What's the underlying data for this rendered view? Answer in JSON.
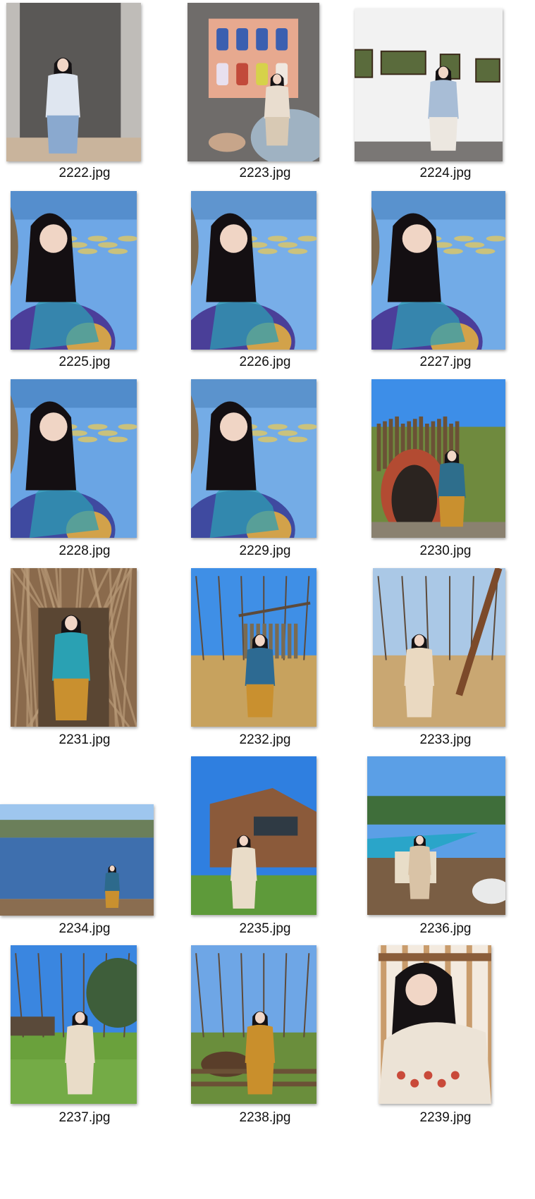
{
  "files": [
    {
      "name": "2222.jpg",
      "scene": "gray-wall-portrait",
      "sky": "#bfbcb8",
      "ground": "#c9b49c",
      "outfit": "#dfe6f0",
      "accent": "#5a5856"
    },
    {
      "name": "2223.jpg",
      "scene": "toy-shelf-interior",
      "sky": "#6f6c6a",
      "ground": "#c7a58a",
      "outfit": "#e9ddcf",
      "accent": "#3b5fb0"
    },
    {
      "name": "2224.jpg",
      "scene": "gallery-wall",
      "sky": "#f2f2f2",
      "ground": "#7a7775",
      "outfit": "#a8bdd6",
      "accent": "#5a6b3c"
    },
    {
      "name": "2225.jpg",
      "scene": "lakeside-sweater",
      "sky": "#6ea7e6",
      "ground": "#7e6a4f",
      "outfit": "#4b3e9a",
      "accent": "#d2a24a"
    },
    {
      "name": "2226.jpg",
      "scene": "lakeside-sweater",
      "sky": "#78aee8",
      "ground": "#7e6a4f",
      "outfit": "#4a3f98",
      "accent": "#d2a24a"
    },
    {
      "name": "2227.jpg",
      "scene": "lakeside-sweater",
      "sky": "#72abe7",
      "ground": "#7e6a4f",
      "outfit": "#4b3e9a",
      "accent": "#d2a24a"
    },
    {
      "name": "2228.jpg",
      "scene": "lakeside-sweater",
      "sky": "#6aa5e4",
      "ground": "#8a6f4e",
      "outfit": "#3f4aa0",
      "accent": "#d2a24a"
    },
    {
      "name": "2229.jpg",
      "scene": "lakeside-sweater",
      "sky": "#74ace6",
      "ground": "#8a6f4e",
      "outfit": "#3f4aa0",
      "accent": "#d2a24a"
    },
    {
      "name": "2230.jpg",
      "scene": "hobbit-door",
      "sky": "#3d8ee8",
      "ground": "#6f8a3e",
      "outfit": "#2e6e8c",
      "accent": "#b34b32"
    },
    {
      "name": "2231.jpg",
      "scene": "branch-hut",
      "sky": "#8a6a4c",
      "ground": "#5a4633",
      "outfit": "#c9902f",
      "accent": "#3aa1a6"
    },
    {
      "name": "2232.jpg",
      "scene": "park-swing",
      "sky": "#3f8fe6",
      "ground": "#c7a25e",
      "outfit": "#2d6a92",
      "accent": "#7a6b52"
    },
    {
      "name": "2233.jpg",
      "scene": "garden-fence",
      "sky": "#aac8e6",
      "ground": "#c9a772",
      "outfit": "#ead9c1",
      "accent": "#7c4a2a"
    },
    {
      "name": "2234.jpg",
      "scene": "wide-lake",
      "sky": "#9ec6ee",
      "ground": "#3e6fae",
      "outfit": "#2d6a8c",
      "accent": "#6b7f5a"
    },
    {
      "name": "2235.jpg",
      "scene": "wooden-house",
      "sky": "#2f7fe0",
      "ground": "#5e9a3a",
      "outfit": "#e9dcc8",
      "accent": "#8b5a3a"
    },
    {
      "name": "2236.jpg",
      "scene": "poolside-chair",
      "sky": "#5b9fe6",
      "ground": "#7a5e44",
      "outfit": "#d9c3a6",
      "accent": "#2aa5c9"
    },
    {
      "name": "2237.jpg",
      "scene": "garden-path",
      "sky": "#3a86e0",
      "ground": "#6aa13c",
      "outfit": "#e9dcc8",
      "accent": "#3e5e3a"
    },
    {
      "name": "2238.jpg",
      "scene": "horse-fence",
      "sky": "#6ea6e6",
      "ground": "#6a8e3c",
      "outfit": "#c98f2c",
      "accent": "#5a3e2a"
    },
    {
      "name": "2239.jpg",
      "scene": "wood-window",
      "sky": "#c99c6c",
      "ground": "#8a5d3a",
      "outfit": "#ece3d6",
      "accent": "#c94a3a"
    }
  ]
}
